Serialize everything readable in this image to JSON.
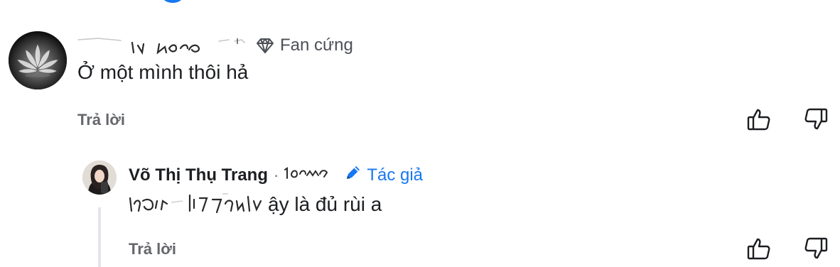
{
  "comment": {
    "badge_label": "Fan cứng",
    "text": "Ở một mình thôi hả",
    "reply_label": "Trả lời"
  },
  "reply": {
    "author_name": "Võ Thị Thụ Trang",
    "separator": "·",
    "author_badge_label": "Tác giả",
    "text_visible": "ậy là đủ rùi a",
    "reply_label": "Trả lời"
  },
  "colors": {
    "accent": "#1877f2",
    "secondary_text": "#65676b",
    "primary_text": "#1c1e21",
    "thread_line": "#e4e6eb"
  },
  "icons": [
    "diamond-icon",
    "pencil-icon",
    "thumbs-up-icon",
    "thumbs-down-icon"
  ]
}
